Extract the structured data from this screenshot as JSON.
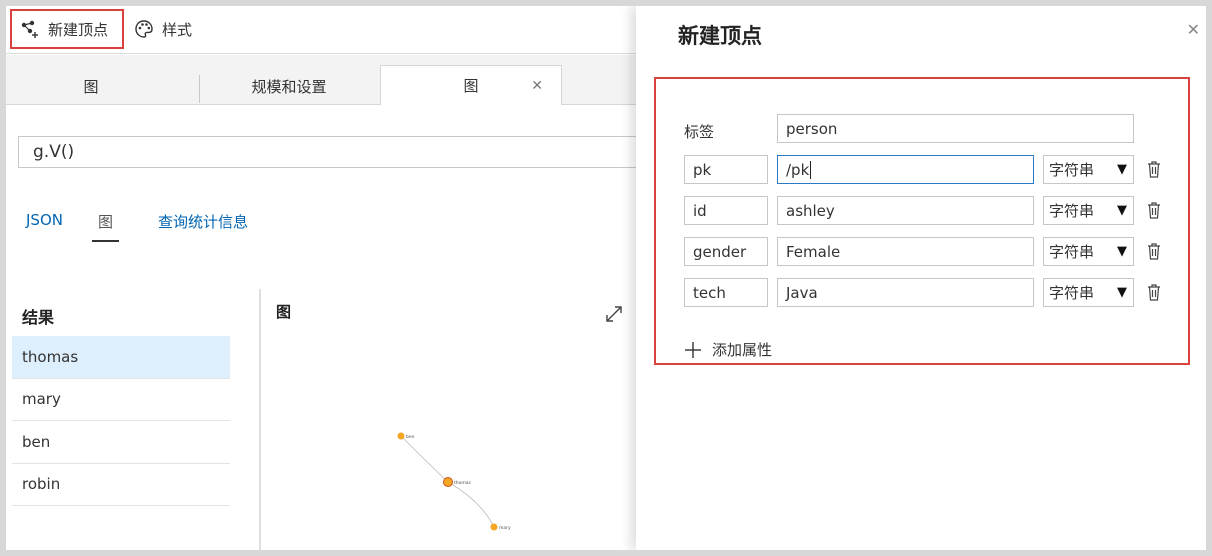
{
  "toolbar": {
    "new_vertex": "新建顶点",
    "style": "样式"
  },
  "tabs": [
    {
      "label": "图"
    },
    {
      "label": "规模和设置"
    },
    {
      "label": "图"
    }
  ],
  "query": {
    "value": "g.V()"
  },
  "subtabs": {
    "json": "JSON",
    "graph": "图",
    "stats": "查询统计信息"
  },
  "results": {
    "header": "结果",
    "items": [
      {
        "label": "thomas"
      },
      {
        "label": "mary"
      },
      {
        "label": "ben"
      },
      {
        "label": "robin"
      }
    ]
  },
  "graph_title": "图",
  "graph_nodes": {
    "ben": "ben",
    "thomas": "thomas",
    "mary": "mary"
  },
  "panel": {
    "title": "新建顶点",
    "label_text": "标签",
    "label_value": "person",
    "rows": [
      {
        "key": "pk",
        "value": "/pk",
        "type": "字符串"
      },
      {
        "key": "id",
        "value": "ashley",
        "type": "字符串"
      },
      {
        "key": "gender",
        "value": "Female",
        "type": "字符串"
      },
      {
        "key": "tech",
        "value": "Java",
        "type": "字符串"
      }
    ],
    "add_property": "添加属性"
  },
  "colors": {
    "highlight_border": "#d9413d",
    "link": "#0065b3",
    "selected_row": "#ddeefc",
    "node": "#f5a623"
  }
}
